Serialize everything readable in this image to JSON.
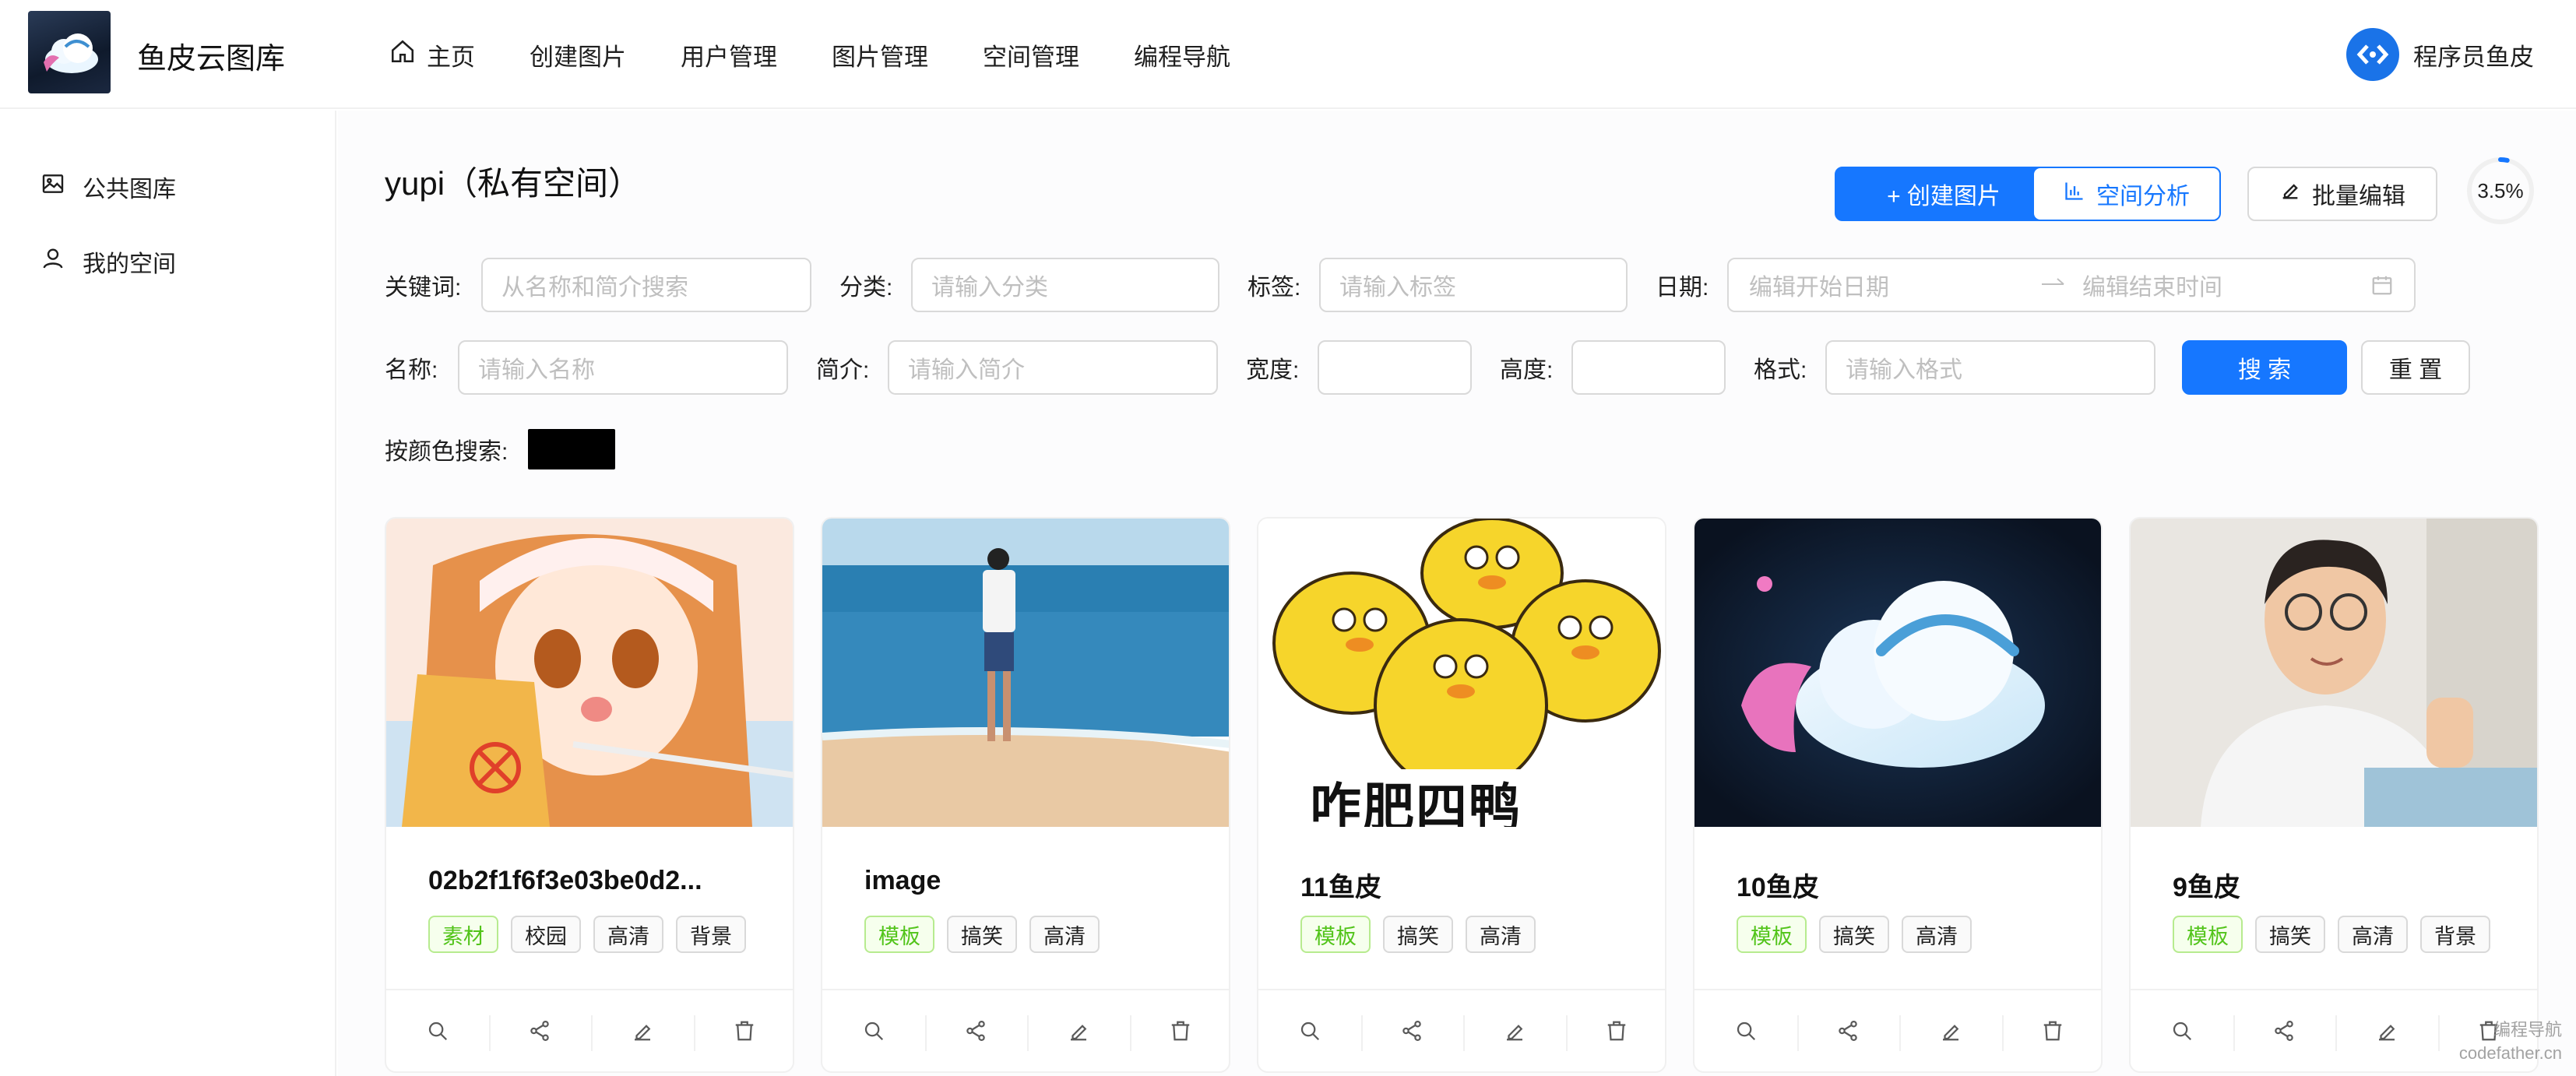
{
  "header": {
    "app_title": "鱼皮云图库",
    "nav": [
      {
        "label": "主页",
        "icon": "home-icon"
      },
      {
        "label": "创建图片"
      },
      {
        "label": "用户管理"
      },
      {
        "label": "图片管理"
      },
      {
        "label": "空间管理"
      },
      {
        "label": "编程导航"
      }
    ],
    "user_name": "程序员鱼皮"
  },
  "sidebar": {
    "items": [
      {
        "label": "公共图库",
        "icon": "picture-icon"
      },
      {
        "label": "我的空间",
        "icon": "user-icon"
      }
    ]
  },
  "space": {
    "title": "yupi（私有空间）",
    "create_button": "+ 创建图片",
    "analyze_button": "空间分析",
    "batch_edit_button": "批量编辑",
    "usage_percent": "3.5%",
    "usage_fraction": 0.035
  },
  "filters": {
    "keyword_label": "关键词:",
    "keyword_placeholder": "从名称和简介搜索",
    "category_label": "分类:",
    "category_placeholder": "请输入分类",
    "tags_label": "标签:",
    "tags_placeholder": "请输入标签",
    "date_label": "日期:",
    "date_start_placeholder": "编辑开始日期",
    "date_end_placeholder": "编辑结束时间",
    "name_label": "名称:",
    "name_placeholder": "请输入名称",
    "intro_label": "简介:",
    "intro_placeholder": "请输入简介",
    "width_label": "宽度:",
    "height_label": "高度:",
    "format_label": "格式:",
    "format_placeholder": "请输入格式",
    "search_button": "搜 索",
    "reset_button": "重 置",
    "color_label": "按颜色搜索:",
    "color_value": "#000000"
  },
  "pictures": [
    {
      "title": "02b2f1f6f3e03be0d2...",
      "tags": [
        "素材",
        "校园",
        "高清",
        "背景"
      ]
    },
    {
      "title": "image",
      "tags": [
        "模板",
        "搞笑",
        "高清"
      ]
    },
    {
      "title": "11鱼皮",
      "tags": [
        "模板",
        "搞笑",
        "高清"
      ]
    },
    {
      "title": "10鱼皮",
      "tags": [
        "模板",
        "搞笑",
        "高清"
      ]
    },
    {
      "title": "9鱼皮",
      "tags": [
        "模板",
        "搞笑",
        "高清",
        "背景"
      ]
    }
  ],
  "card_image_text": "咋肥四鸭",
  "watermark": [
    "编程导航",
    "codefather.cn"
  ],
  "colors": {
    "primary": "#1677ff",
    "tag_green": "#52c41a"
  }
}
